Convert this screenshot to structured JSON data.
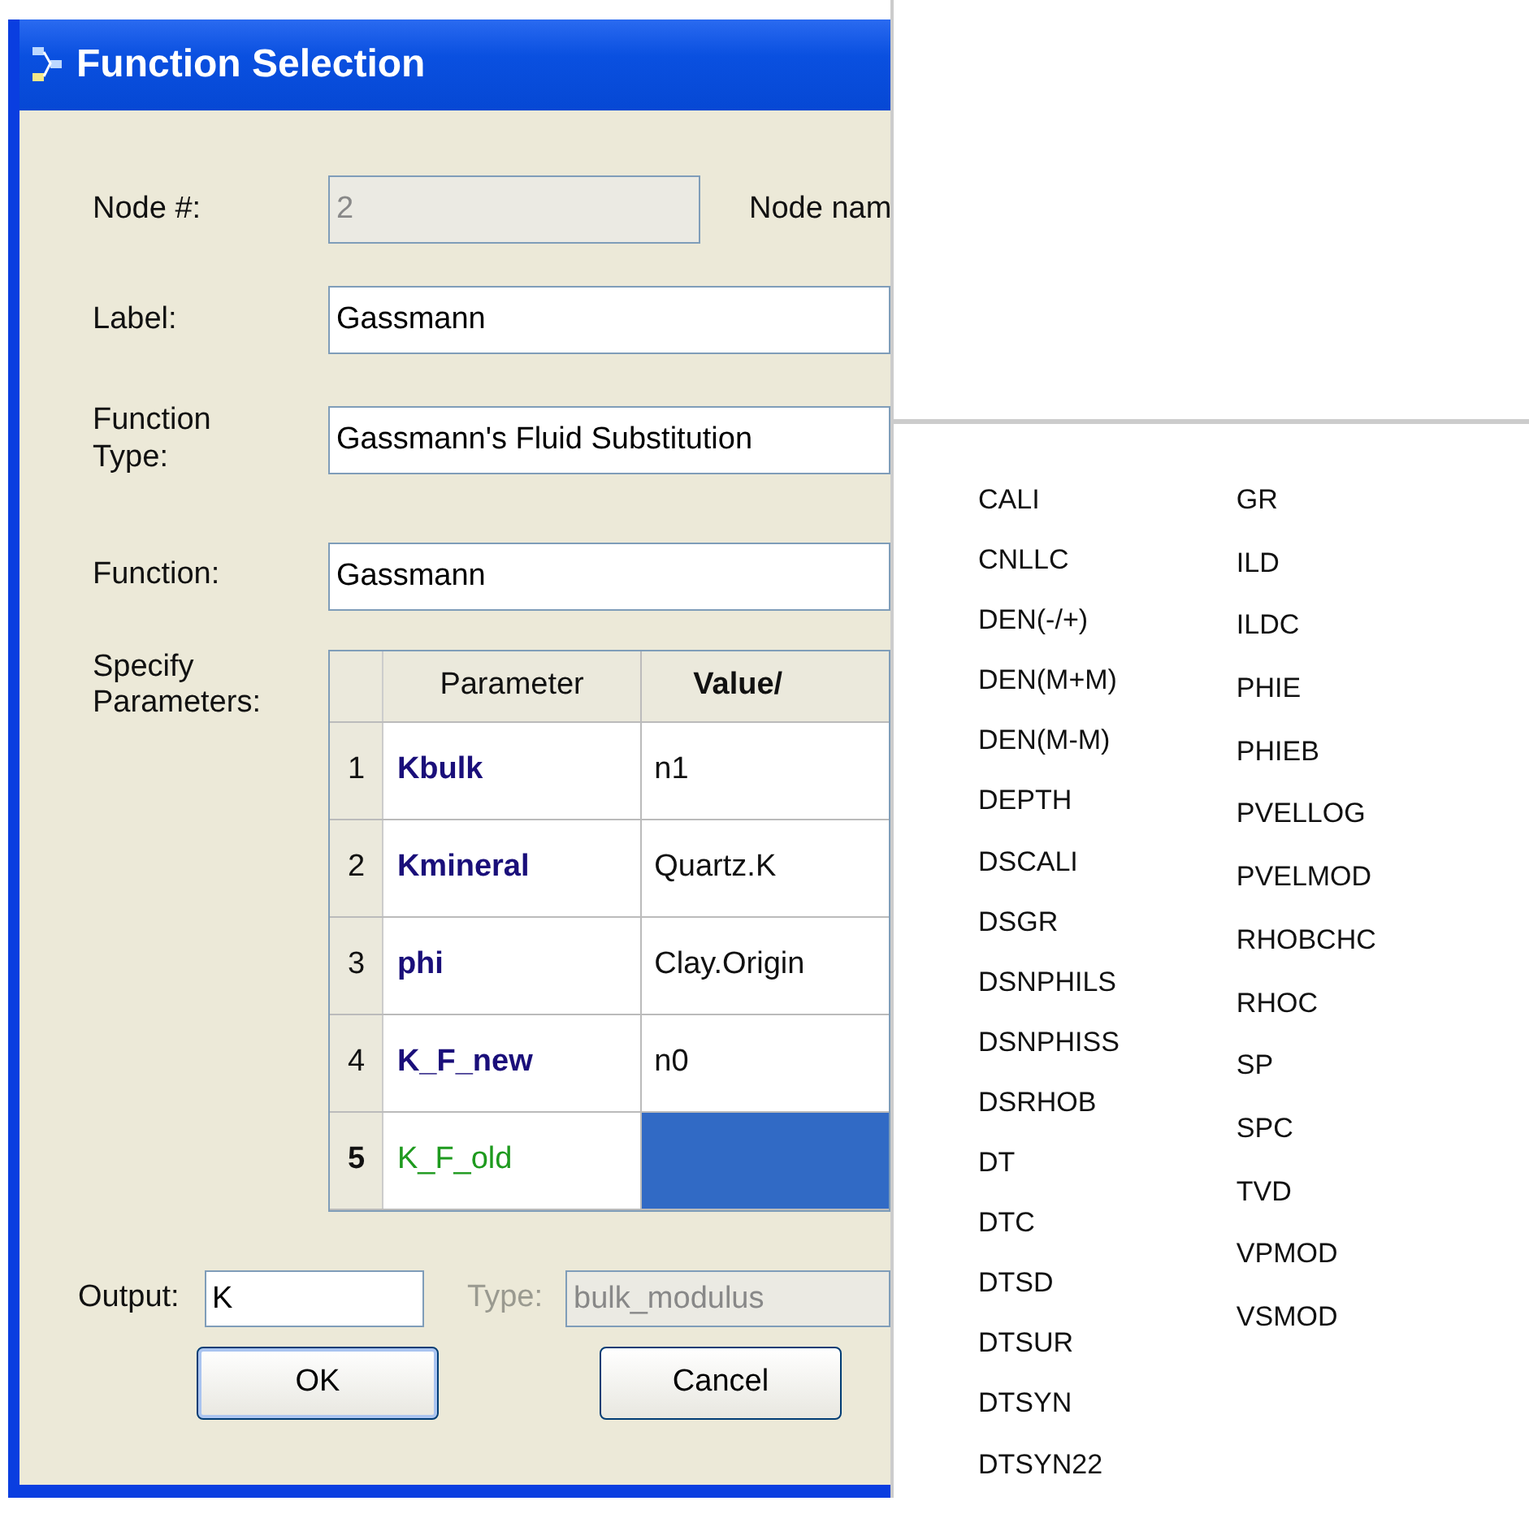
{
  "window": {
    "title": "Function Selection"
  },
  "node": {
    "label": "Node #:",
    "value": "2",
    "disabled": true
  },
  "node_name": {
    "label": "Node nam"
  },
  "label_field": {
    "label": "Label:",
    "value": "Gassmann"
  },
  "function_type": {
    "label": "Function Type:",
    "value": "Gassmann's Fluid Substitution"
  },
  "function": {
    "label": "Function:",
    "value": "Gassmann"
  },
  "parameters": {
    "label": "Specify Parameters:",
    "columns": [
      "Parameter",
      "Value/"
    ],
    "rows": [
      {
        "number": "1",
        "name": "Kbulk",
        "value": "n1",
        "kind": "required",
        "selected": false
      },
      {
        "number": "2",
        "name": "Kmineral",
        "value": "Quartz.K",
        "kind": "required",
        "selected": false
      },
      {
        "number": "3",
        "name": "phi",
        "value": "Clay.Origin",
        "kind": "required",
        "selected": false
      },
      {
        "number": "4",
        "name": "K_F_new",
        "value": "n0",
        "kind": "required",
        "selected": false
      },
      {
        "number": "5",
        "name": "K_F_old",
        "value": "",
        "kind": "optional",
        "selected": true
      }
    ]
  },
  "output": {
    "label": "Output:",
    "value": "K"
  },
  "type": {
    "label": "Type:",
    "value": "bulk_modulus",
    "disabled": true
  },
  "buttons": [
    "OK",
    "Cancel"
  ],
  "popup_list": {
    "columns": [
      [
        "CALI",
        "CNLLC",
        "DEN(-/+)",
        "DEN(M+M)",
        "DEN(M-M)",
        "DEPTH",
        "DSCALI",
        "DSGR",
        "DSNPHILS",
        "DSNPHISS",
        "DSRHOB",
        "DT",
        "DTC",
        "DTSD",
        "DTSUR",
        "DTSYN",
        "DTSYN22"
      ],
      [
        "GR",
        "ILD",
        "ILDC",
        "PHIE",
        "PHIEB",
        "PVELLOG",
        "PVELMOD",
        "RHOBCHC",
        "RHOC",
        "SP",
        "SPC",
        "TVD",
        "VPMOD",
        "VSMOD"
      ]
    ]
  }
}
